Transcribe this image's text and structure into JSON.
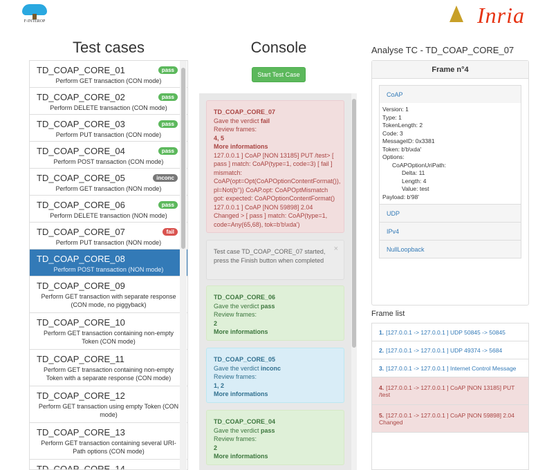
{
  "header": {
    "logo_left_text": "F-INTEROP",
    "logo_right_text": "Inria"
  },
  "test_cases": {
    "title": "Test cases",
    "items": [
      {
        "name": "TD_COAP_CORE_01",
        "desc": "Perform GET transaction (CON mode)",
        "badge": "pass"
      },
      {
        "name": "TD_COAP_CORE_02",
        "desc": "Perform DELETE transaction (CON mode)",
        "badge": "pass"
      },
      {
        "name": "TD_COAP_CORE_03",
        "desc": "Perform PUT transaction (CON mode)",
        "badge": "pass"
      },
      {
        "name": "TD_COAP_CORE_04",
        "desc": "Perform POST transaction (CON mode)",
        "badge": "pass"
      },
      {
        "name": "TD_COAP_CORE_05",
        "desc": "Perform GET transaction (NON mode)",
        "badge": "inconc"
      },
      {
        "name": "TD_COAP_CORE_06",
        "desc": "Perform DELETE transaction (NON mode)",
        "badge": "pass"
      },
      {
        "name": "TD_COAP_CORE_07",
        "desc": "Perform PUT transaction (NON mode)",
        "badge": "fail"
      },
      {
        "name": "TD_COAP_CORE_08",
        "desc": "Perform POST transaction (NON mode)",
        "badge": ""
      },
      {
        "name": "TD_COAP_CORE_09",
        "desc": "Perform GET transaction with separate response (CON mode, no piggyback)",
        "badge": ""
      },
      {
        "name": "TD_COAP_CORE_10",
        "desc": "Perform GET transaction containing non-empty Token (CON mode)",
        "badge": ""
      },
      {
        "name": "TD_COAP_CORE_11",
        "desc": "Perform GET transaction containing non-empty Token with a separate response (CON mode)",
        "badge": ""
      },
      {
        "name": "TD_COAP_CORE_12",
        "desc": "Perform GET transaction using empty Token (CON mode)",
        "badge": ""
      },
      {
        "name": "TD_COAP_CORE_13",
        "desc": "Perform GET transaction containing several URI-Path options (CON mode)",
        "badge": ""
      },
      {
        "name": "TD_COAP_CORE_14",
        "desc": "",
        "badge": ""
      }
    ]
  },
  "console": {
    "title": "Console",
    "start_button": "Start Test Case",
    "messages": {
      "m1": {
        "tc": "TD_COAP_CORE_07",
        "verdict_prefix": "Gave the verdict ",
        "verdict": "fail",
        "review": "Review frames:",
        "frames": "4, 5",
        "more": "More informations",
        "detail": "127.0.0.1 ] CoAP [NON 13185] PUT /test> [ pass ] match: CoAP(type=1, code=3) [ fail ] mismatch: CoAP(opt=Opt(CoAPOptionContentFormat()), pl=Not(b'')) CoAP.opt: CoAPOptMismatch got: expected: CoAPOptionContentFormat() 127.0.0.1 ] CoAP [NON 59898] 2.04 Changed > [ pass ] match: CoAP(type=1, code=Any(65,68), tok=b'b\\xda')"
      },
      "m2": {
        "text": "Test case TD_COAP_CORE_07 started, press the Finish button when completed",
        "close": "×"
      },
      "m3": {
        "tc": "TD_COAP_CORE_06",
        "verdict_prefix": "Gave the verdict ",
        "verdict": "pass",
        "review": "Review frames:",
        "frames": "2",
        "more": "More informations"
      },
      "m4": {
        "tc": "TD_COAP_CORE_05",
        "verdict_prefix": "Gave the verdict ",
        "verdict": "inconc",
        "review": "Review frames:",
        "frames": "1, 2",
        "more": "More informations"
      },
      "m5": {
        "tc": "TD_COAP_CORE_04",
        "verdict_prefix": "Gave the verdict ",
        "verdict": "pass",
        "review": "Review frames:",
        "frames": "2",
        "more": "More informations"
      }
    }
  },
  "analyse": {
    "title": "Analyse TC - TD_COAP_CORE_07",
    "frame_title": "Frame n°4",
    "layers": {
      "coap": {
        "name": "CoAP",
        "lines": [
          "Version: 1",
          "Type: 1",
          "TokenLength: 2",
          "Code: 3",
          "MessageID: 0x3381",
          "Token: b'b\\xda'",
          "Options:"
        ],
        "opt_name": "CoAPOptionUriPath:",
        "opt_lines": [
          "Delta: 11",
          "Length: 4",
          "Value: test"
        ],
        "payload": "Payload: b'98'"
      },
      "udp": "UDP",
      "ipv4": "IPv4",
      "null": "NullLoopback"
    }
  },
  "frame_list": {
    "title": "Frame list",
    "items": [
      {
        "n": "1.",
        "text": "[127.0.0.1 -> 127.0.0.1 ] UDP 50845 -> 50845"
      },
      {
        "n": "2.",
        "text": "[127.0.0.1 -> 127.0.0.1 ] UDP 49374 -> 5684"
      },
      {
        "n": "3.",
        "text": "[127.0.0.1 -> 127.0.0.1 ] Internet Control Message"
      },
      {
        "n": "4.",
        "text": "[127.0.0.1 -> 127.0.0.1 ] CoAP [NON 13185] PUT /test"
      },
      {
        "n": "5.",
        "text": "[127.0.0.1 -> 127.0.0.1 ] CoAP [NON 59898] 2.04 Changed"
      }
    ]
  }
}
